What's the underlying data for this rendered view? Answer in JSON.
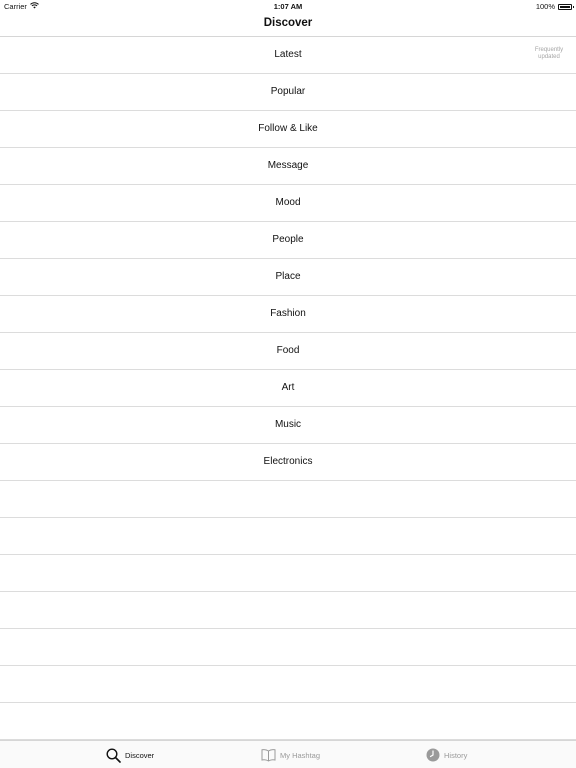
{
  "status_bar": {
    "carrier": "Carrier",
    "time": "1:07 AM",
    "battery": "100%",
    "wifi_icon": "wifi-icon",
    "battery_icon": "battery-icon"
  },
  "nav": {
    "title": "Discover"
  },
  "list": {
    "items": [
      {
        "label": "Latest",
        "note": "Frequently updated"
      },
      {
        "label": "Popular"
      },
      {
        "label": "Follow & Like"
      },
      {
        "label": "Message"
      },
      {
        "label": "Mood"
      },
      {
        "label": "People"
      },
      {
        "label": "Place"
      },
      {
        "label": "Fashion"
      },
      {
        "label": "Food"
      },
      {
        "label": "Art"
      },
      {
        "label": "Music"
      },
      {
        "label": "Electronics"
      }
    ]
  },
  "tab_bar": {
    "tabs": [
      {
        "label": "Discover",
        "icon": "search-icon",
        "selected": true
      },
      {
        "label": "My Hashtag",
        "icon": "book-icon",
        "selected": false
      },
      {
        "label": "History",
        "icon": "clock-icon",
        "selected": false
      }
    ]
  },
  "colors": {
    "active": "#111111",
    "inactive": "#9a9a9a",
    "separator": "#dcdcdc"
  }
}
